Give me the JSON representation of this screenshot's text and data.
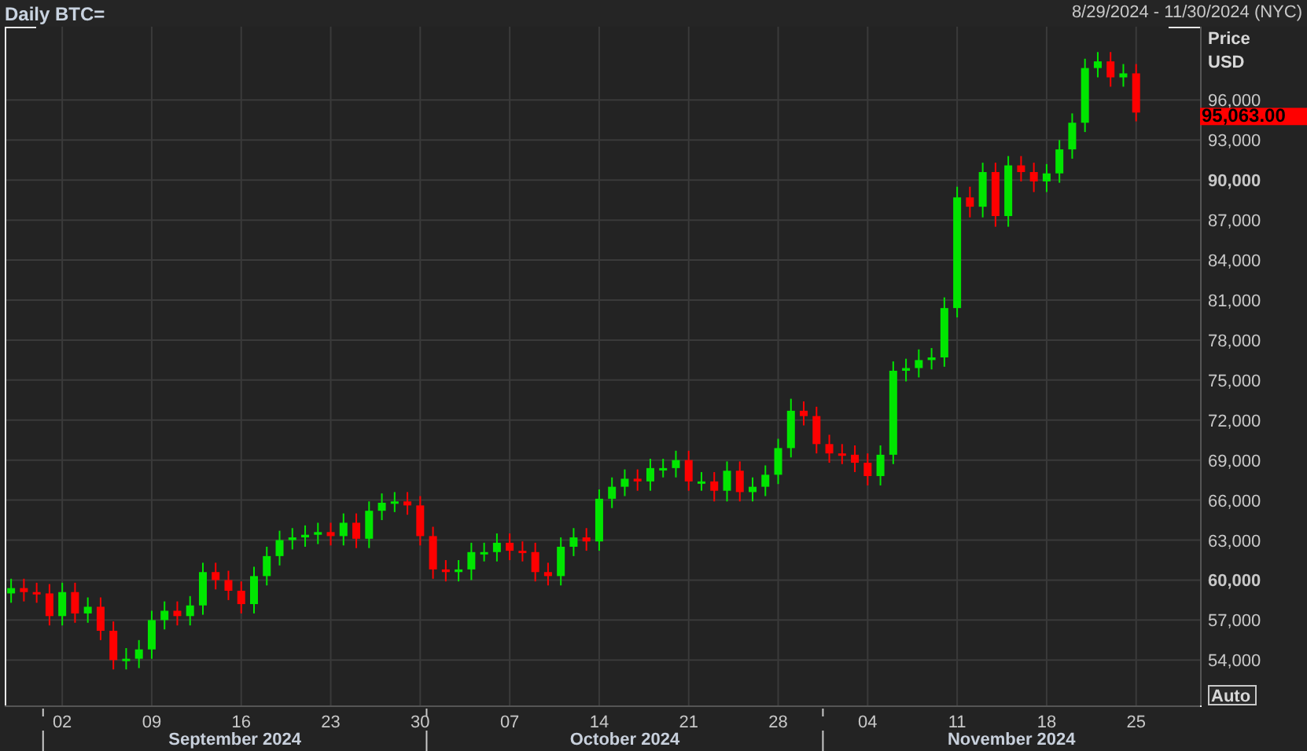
{
  "header": {
    "title": "Daily BTC=",
    "date_range": "8/29/2024 - 11/30/2024 (NYC)"
  },
  "chart": {
    "axis_title": [
      "Price",
      "USD"
    ],
    "last_price": "95,063.00",
    "scale_button": "Auto",
    "months": [
      {
        "label": "September 2024"
      },
      {
        "label": "October 2024"
      },
      {
        "label": "November 2024"
      }
    ],
    "chart_data": {
      "type": "candlestick",
      "grid": true,
      "ylim": [
        50600,
        101500
      ],
      "categories": [
        null,
        null,
        null,
        null,
        "02",
        null,
        null,
        null,
        null,
        null,
        null,
        "09",
        null,
        null,
        null,
        null,
        null,
        null,
        "16",
        null,
        null,
        null,
        null,
        null,
        null,
        "23",
        null,
        null,
        null,
        null,
        null,
        null,
        "30",
        null,
        null,
        null,
        null,
        null,
        null,
        "07",
        null,
        null,
        null,
        null,
        null,
        null,
        "14",
        null,
        null,
        null,
        null,
        null,
        null,
        "21",
        null,
        null,
        null,
        null,
        null,
        null,
        "28",
        null,
        null,
        null,
        null,
        null,
        null,
        "04",
        null,
        null,
        null,
        null,
        null,
        null,
        "11",
        null,
        null,
        null,
        null,
        null,
        null,
        "18",
        null,
        null,
        null,
        null,
        null,
        null,
        "25"
      ],
      "ohlc": [
        [
          59000,
          60100,
          58300,
          59400
        ],
        [
          59400,
          60100,
          58400,
          59100
        ],
        [
          59100,
          59800,
          58300,
          59000
        ],
        [
          59000,
          59700,
          56600,
          57300
        ],
        [
          57300,
          59800,
          56600,
          59100
        ],
        [
          59100,
          59800,
          56800,
          57500
        ],
        [
          57500,
          58700,
          56800,
          58000
        ],
        [
          58000,
          58700,
          55500,
          56200
        ],
        [
          56200,
          56900,
          53300,
          54000
        ],
        [
          54000,
          54900,
          53300,
          54100
        ],
        [
          54100,
          55500,
          53400,
          54800
        ],
        [
          54800,
          57700,
          54100,
          57000
        ],
        [
          57000,
          58400,
          56300,
          57700
        ],
        [
          57700,
          58400,
          56600,
          57300
        ],
        [
          57300,
          58800,
          56600,
          58100
        ],
        [
          58100,
          61300,
          57400,
          60600
        ],
        [
          60600,
          61300,
          59300,
          60000
        ],
        [
          60000,
          60700,
          58500,
          59200
        ],
        [
          59200,
          59900,
          57500,
          58200
        ],
        [
          58200,
          61000,
          57500,
          60300
        ],
        [
          60300,
          62500,
          59600,
          61800
        ],
        [
          61800,
          63700,
          61100,
          63000
        ],
        [
          63000,
          63900,
          62300,
          63200
        ],
        [
          63200,
          64100,
          62500,
          63400
        ],
        [
          63400,
          64300,
          62700,
          63600
        ],
        [
          63600,
          64300,
          62600,
          63300
        ],
        [
          63300,
          65000,
          62600,
          64300
        ],
        [
          64300,
          65000,
          62400,
          63100
        ],
        [
          63100,
          65900,
          62400,
          65200
        ],
        [
          65200,
          66500,
          64500,
          65800
        ],
        [
          65800,
          66600,
          65100,
          65900
        ],
        [
          65900,
          66600,
          64900,
          65600
        ],
        [
          65600,
          66300,
          62600,
          63300
        ],
        [
          63300,
          64000,
          60100,
          60800
        ],
        [
          60800,
          61500,
          59900,
          60600
        ],
        [
          60600,
          61500,
          59900,
          60800
        ],
        [
          60800,
          62800,
          60000,
          62100
        ],
        [
          62100,
          62800,
          61400,
          62100
        ],
        [
          62100,
          63500,
          61400,
          62800
        ],
        [
          62800,
          63500,
          61500,
          62200
        ],
        [
          62200,
          62900,
          61400,
          62100
        ],
        [
          62100,
          62800,
          59900,
          60600
        ],
        [
          60600,
          61300,
          59600,
          60300
        ],
        [
          60300,
          63200,
          59600,
          62500
        ],
        [
          62500,
          63900,
          61800,
          63200
        ],
        [
          63200,
          63900,
          62200,
          62900
        ],
        [
          62900,
          66800,
          62200,
          66100
        ],
        [
          66100,
          67700,
          65400,
          67000
        ],
        [
          67000,
          68300,
          66300,
          67600
        ],
        [
          67600,
          68300,
          66700,
          67400
        ],
        [
          67400,
          69100,
          66700,
          68400
        ],
        [
          68400,
          69100,
          67700,
          68400
        ],
        [
          68400,
          69700,
          67700,
          69000
        ],
        [
          69000,
          69700,
          66700,
          67400
        ],
        [
          67400,
          68100,
          66700,
          67400
        ],
        [
          67400,
          68100,
          65900,
          66700
        ],
        [
          66700,
          68900,
          65900,
          68200
        ],
        [
          68200,
          68900,
          65900,
          66600
        ],
        [
          66600,
          67700,
          65900,
          67000
        ],
        [
          67000,
          68600,
          66300,
          67900
        ],
        [
          67900,
          70600,
          67200,
          69900
        ],
        [
          69900,
          73600,
          69200,
          72700
        ],
        [
          72700,
          73400,
          71600,
          72300
        ],
        [
          72300,
          73000,
          69500,
          70200
        ],
        [
          70200,
          70900,
          68800,
          69500
        ],
        [
          69500,
          70200,
          68700,
          69400
        ],
        [
          69400,
          70100,
          68100,
          68800
        ],
        [
          68800,
          69500,
          67100,
          67800
        ],
        [
          67800,
          70100,
          67100,
          69400
        ],
        [
          69400,
          76400,
          68700,
          75700
        ],
        [
          75700,
          76600,
          74900,
          75900
        ],
        [
          75900,
          77300,
          75200,
          76500
        ],
        [
          76500,
          77400,
          75800,
          76700
        ],
        [
          76700,
          81200,
          76000,
          80400
        ],
        [
          80400,
          89500,
          79700,
          88700
        ],
        [
          88700,
          89500,
          87200,
          88000
        ],
        [
          88000,
          91300,
          87200,
          90600
        ],
        [
          90600,
          91300,
          86500,
          87300
        ],
        [
          87300,
          91800,
          86500,
          91100
        ],
        [
          91100,
          91800,
          89900,
          90600
        ],
        [
          90600,
          91300,
          89100,
          89900
        ],
        [
          89900,
          91200,
          89100,
          90500
        ],
        [
          90500,
          93000,
          89800,
          92300
        ],
        [
          92300,
          95000,
          91600,
          94300
        ],
        [
          94300,
          99100,
          93600,
          98400
        ],
        [
          98400,
          99600,
          97700,
          98900
        ],
        [
          98900,
          99600,
          97000,
          97700
        ],
        [
          97700,
          98700,
          97000,
          98000
        ],
        [
          98000,
          98700,
          94400,
          95063
        ]
      ],
      "yticks": [
        {
          "value": 54000,
          "label": "54,000"
        },
        {
          "value": 57000,
          "label": "57,000"
        },
        {
          "value": 60000,
          "label": "60,000"
        },
        {
          "value": 63000,
          "label": "63,000"
        },
        {
          "value": 66000,
          "label": "66,000"
        },
        {
          "value": 69000,
          "label": "69,000"
        },
        {
          "value": 72000,
          "label": "72,000"
        },
        {
          "value": 75000,
          "label": "75,000"
        },
        {
          "value": 78000,
          "label": "78,000"
        },
        {
          "value": 81000,
          "label": "81,000"
        },
        {
          "value": 84000,
          "label": "84,000"
        },
        {
          "value": 87000,
          "label": "87,000"
        },
        {
          "value": 90000,
          "label": "90,000"
        },
        {
          "value": 93000,
          "label": "93,000"
        },
        {
          "value": 96000,
          "label": "96,000"
        }
      ]
    }
  }
}
